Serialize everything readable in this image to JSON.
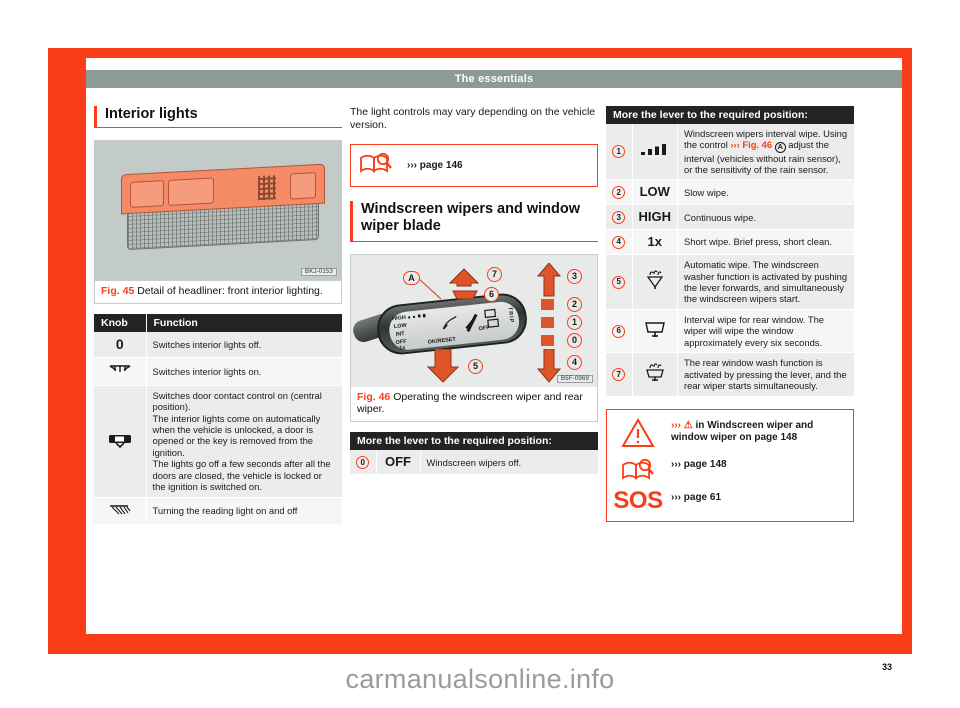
{
  "page": {
    "running_header": "The essentials",
    "page_number": "33",
    "watermark": "carmanualsonline.info"
  },
  "left_column": {
    "heading": "Interior lights",
    "figure": {
      "id_label": "BKJ-0153",
      "caption_label": "Fig. 45",
      "caption_text": "Detail of headliner: front interior lighting."
    },
    "table": {
      "headers": [
        "Knob",
        "Function"
      ],
      "rows": [
        {
          "icon": "0",
          "icon_name": "zero-knob-icon",
          "text": "Switches interior lights off."
        },
        {
          "icon": "☀",
          "icon_name": "interior-light-on-icon",
          "text": "Switches interior lights on."
        },
        {
          "icon": "⊟",
          "icon_name": "door-contact-control-icon",
          "text": "Switches door contact control on (central position).\nThe interior lights come on automatically when the vehicle is unlocked, a door is opened or the key is removed from the ignition.\nThe lights go off a few seconds after all the doors are closed, the vehicle is locked or the ignition is switched on."
        },
        {
          "icon": "≡",
          "icon_name": "reading-light-icon",
          "text": "Turning the reading light on and off"
        }
      ]
    }
  },
  "middle_column": {
    "intro_text": "The light controls may vary depending on the vehicle version.",
    "reference_box": {
      "icon_name": "book-magnifier-icon",
      "text": "››› page 146"
    },
    "heading": "Windscreen wipers and window wiper blade",
    "figure": {
      "id_label": "B5F-0969",
      "caption_label": "Fig. 46",
      "caption_text": "Operating the windscreen wiper and rear wiper.",
      "lever_labels": [
        "HIGH",
        "LOW",
        "INT",
        "OFF",
        "1x"
      ],
      "lever_center_text": "OK/RESET",
      "lever_off_text": "OFF",
      "lever_trip_text": "TRIP",
      "callouts": [
        "A",
        "0",
        "1",
        "2",
        "3",
        "4",
        "5",
        "6",
        "7"
      ]
    },
    "table": {
      "header": "More the lever to the required position:",
      "rows": [
        {
          "num": "0",
          "num_style": "circle",
          "symbol": "OFF",
          "text": "Windscreen wipers off."
        }
      ]
    }
  },
  "right_column": {
    "table": {
      "header": "More the lever to the required position:",
      "rows": [
        {
          "num": "1",
          "icon_name": "interval-bars-icon",
          "symbol": "▂▄▆█",
          "text_before": "Windscreen wipers interval wipe. Using the control ",
          "chevron": "››› ",
          "fig_ref": "Fig. 46",
          "inline_a": "A",
          "text_after": " adjust the interval (vehicles without rain sensor), or the sensitivity of the rain sensor."
        },
        {
          "num": "2",
          "icon_name": "low-speed-icon",
          "symbol": "LOW",
          "text": "Slow wipe."
        },
        {
          "num": "3",
          "icon_name": "high-speed-icon",
          "symbol": "HIGH",
          "text": "Continuous wipe."
        },
        {
          "num": "4",
          "icon_name": "single-wipe-icon",
          "symbol": "1x",
          "text": "Short wipe. Brief press, short clean."
        },
        {
          "num": "5",
          "icon_name": "windscreen-washer-icon",
          "symbol": "☂",
          "text": "Automatic wipe. The windscreen washer function is activated by pushing the lever forwards, and simultaneously the windscreen wipers start."
        },
        {
          "num": "6",
          "icon_name": "rear-wiper-icon",
          "symbol": "▭",
          "text": "Interval wipe for rear window. The wiper will wipe the window approximately every six seconds."
        },
        {
          "num": "7",
          "icon_name": "rear-washer-icon",
          "symbol": "☂",
          "text": "The rear window wash function is activated by pressing the lever, and the rear wiper starts simultaneously."
        }
      ]
    },
    "reference_box": {
      "rows": [
        {
          "icon_name": "warning-triangle-icon",
          "chevron": "››› ",
          "inline_warning": "⚠",
          "text": " in Windscreen wiper and window wiper on page 148"
        },
        {
          "icon_name": "book-magnifier-icon",
          "text": "››› page 148"
        },
        {
          "icon_name": "sos-icon",
          "sos_label": "SOS",
          "text": "››› page 61"
        }
      ]
    }
  },
  "colors": {
    "brand_red": "#f93d18",
    "header_grey": "#8c9a99",
    "table_header_dark": "#232323",
    "row_shade": "#ececec"
  }
}
